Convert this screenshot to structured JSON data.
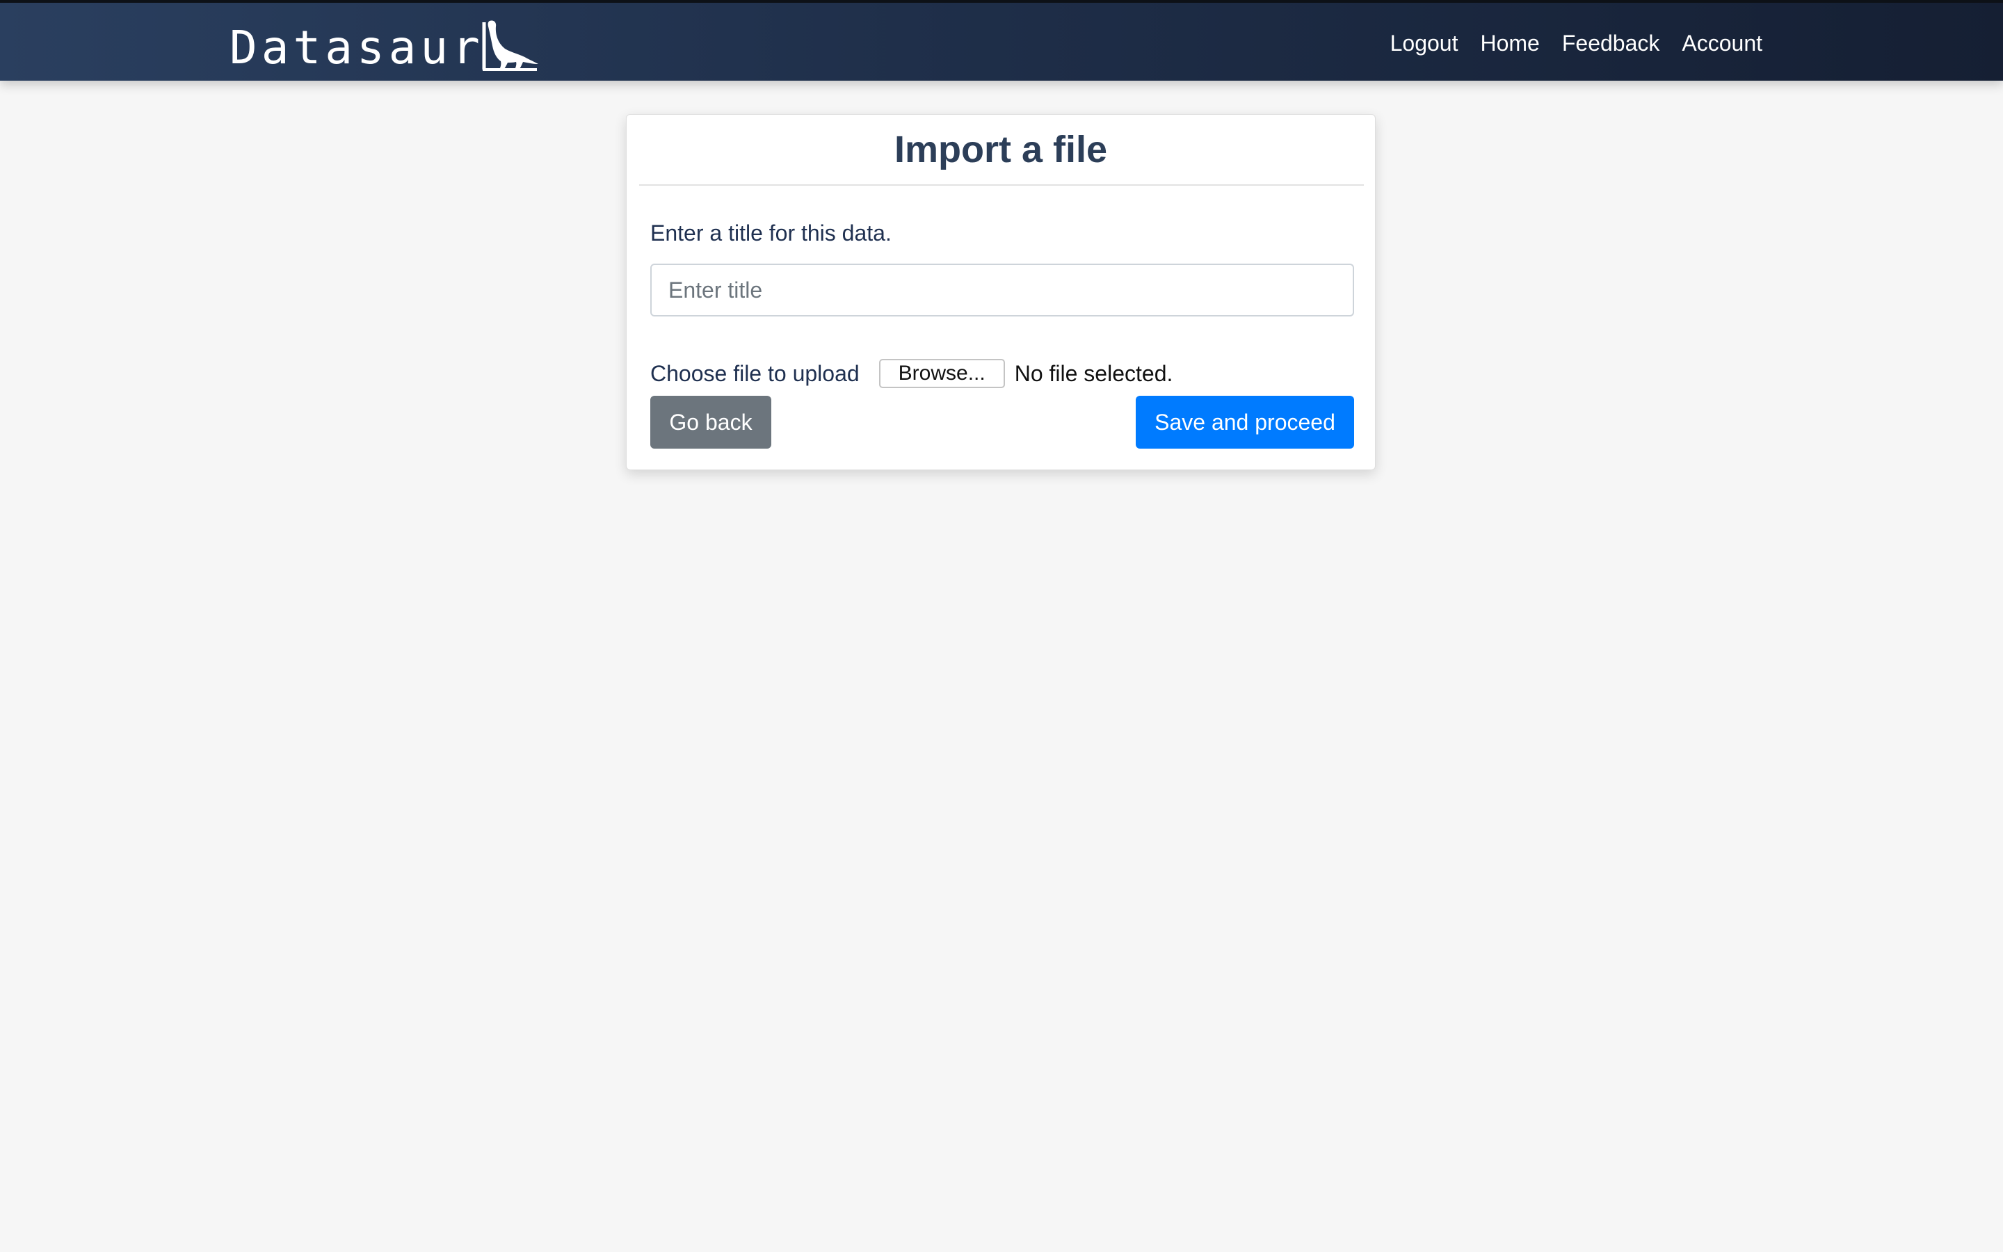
{
  "navbar": {
    "brand": "Datasaur",
    "links": [
      "Logout",
      "Home",
      "Feedback",
      "Account"
    ]
  },
  "card": {
    "title": "Import a file",
    "title_label": "Enter a title for this data.",
    "title_placeholder": "Enter title",
    "title_value": "",
    "file_label": "Choose file to upload",
    "browse_label": "Browse...",
    "file_status": "No file selected.",
    "back_label": "Go back",
    "save_label": "Save and proceed"
  },
  "colors": {
    "navbar": "#1f2f4a",
    "background": "#f6f6f6",
    "primary": "#007bff",
    "secondary": "#6c757d",
    "heading": "#2c3e58"
  },
  "icons": {
    "brand_logo": "dinosaur-icon"
  }
}
